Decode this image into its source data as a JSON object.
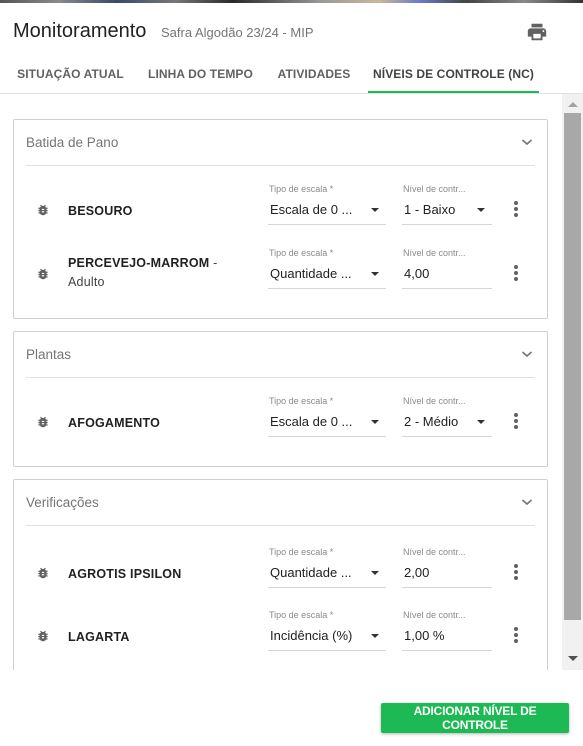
{
  "header": {
    "title": "Monitoramento",
    "subtitle": "Safra Algodão 23/24 - MIP",
    "print_icon": "printer-icon"
  },
  "tabs": [
    {
      "label": "SITUAÇÃO ATUAL",
      "active": false
    },
    {
      "label": "LINHA DO TEMPO",
      "active": false
    },
    {
      "label": "ATIVIDADES",
      "active": false
    },
    {
      "label": "NÍVEIS DE CONTROLE (NC)",
      "active": true
    }
  ],
  "field_labels": {
    "tipo": "Tipo de escala *",
    "nivel": "Nível de contr..."
  },
  "groups": [
    {
      "title": "Batida de Pano",
      "items": [
        {
          "name": "BESOURO",
          "sub": "",
          "tipo": "Escala de 0 ...",
          "nivel": "1 - Baixo",
          "nivel_is_select": true
        },
        {
          "name": "PERCEVEJO-MARROM",
          "sub": "Adulto",
          "tipo": "Quantidade ...",
          "nivel": "4,00",
          "nivel_is_select": false
        }
      ]
    },
    {
      "title": "Plantas",
      "items": [
        {
          "name": "AFOGAMENTO",
          "sub": "",
          "tipo": "Escala de 0 ...",
          "nivel": "2 - Médio",
          "nivel_is_select": true
        }
      ]
    },
    {
      "title": "Verificações",
      "items": [
        {
          "name": "AGROTIS IPSILON",
          "sub": "",
          "tipo": "Quantidade ...",
          "nivel": "2,00",
          "nivel_is_select": false
        },
        {
          "name": "LAGARTA",
          "sub": "",
          "tipo": "Incidência (%)",
          "nivel": "1,00 %",
          "nivel_is_select": false
        }
      ]
    }
  ],
  "actions": {
    "add_label": "ADICIONAR NÍVEL DE CONTROLE"
  },
  "colors": {
    "accent": "#1db954",
    "icon_gray": "#616161"
  }
}
